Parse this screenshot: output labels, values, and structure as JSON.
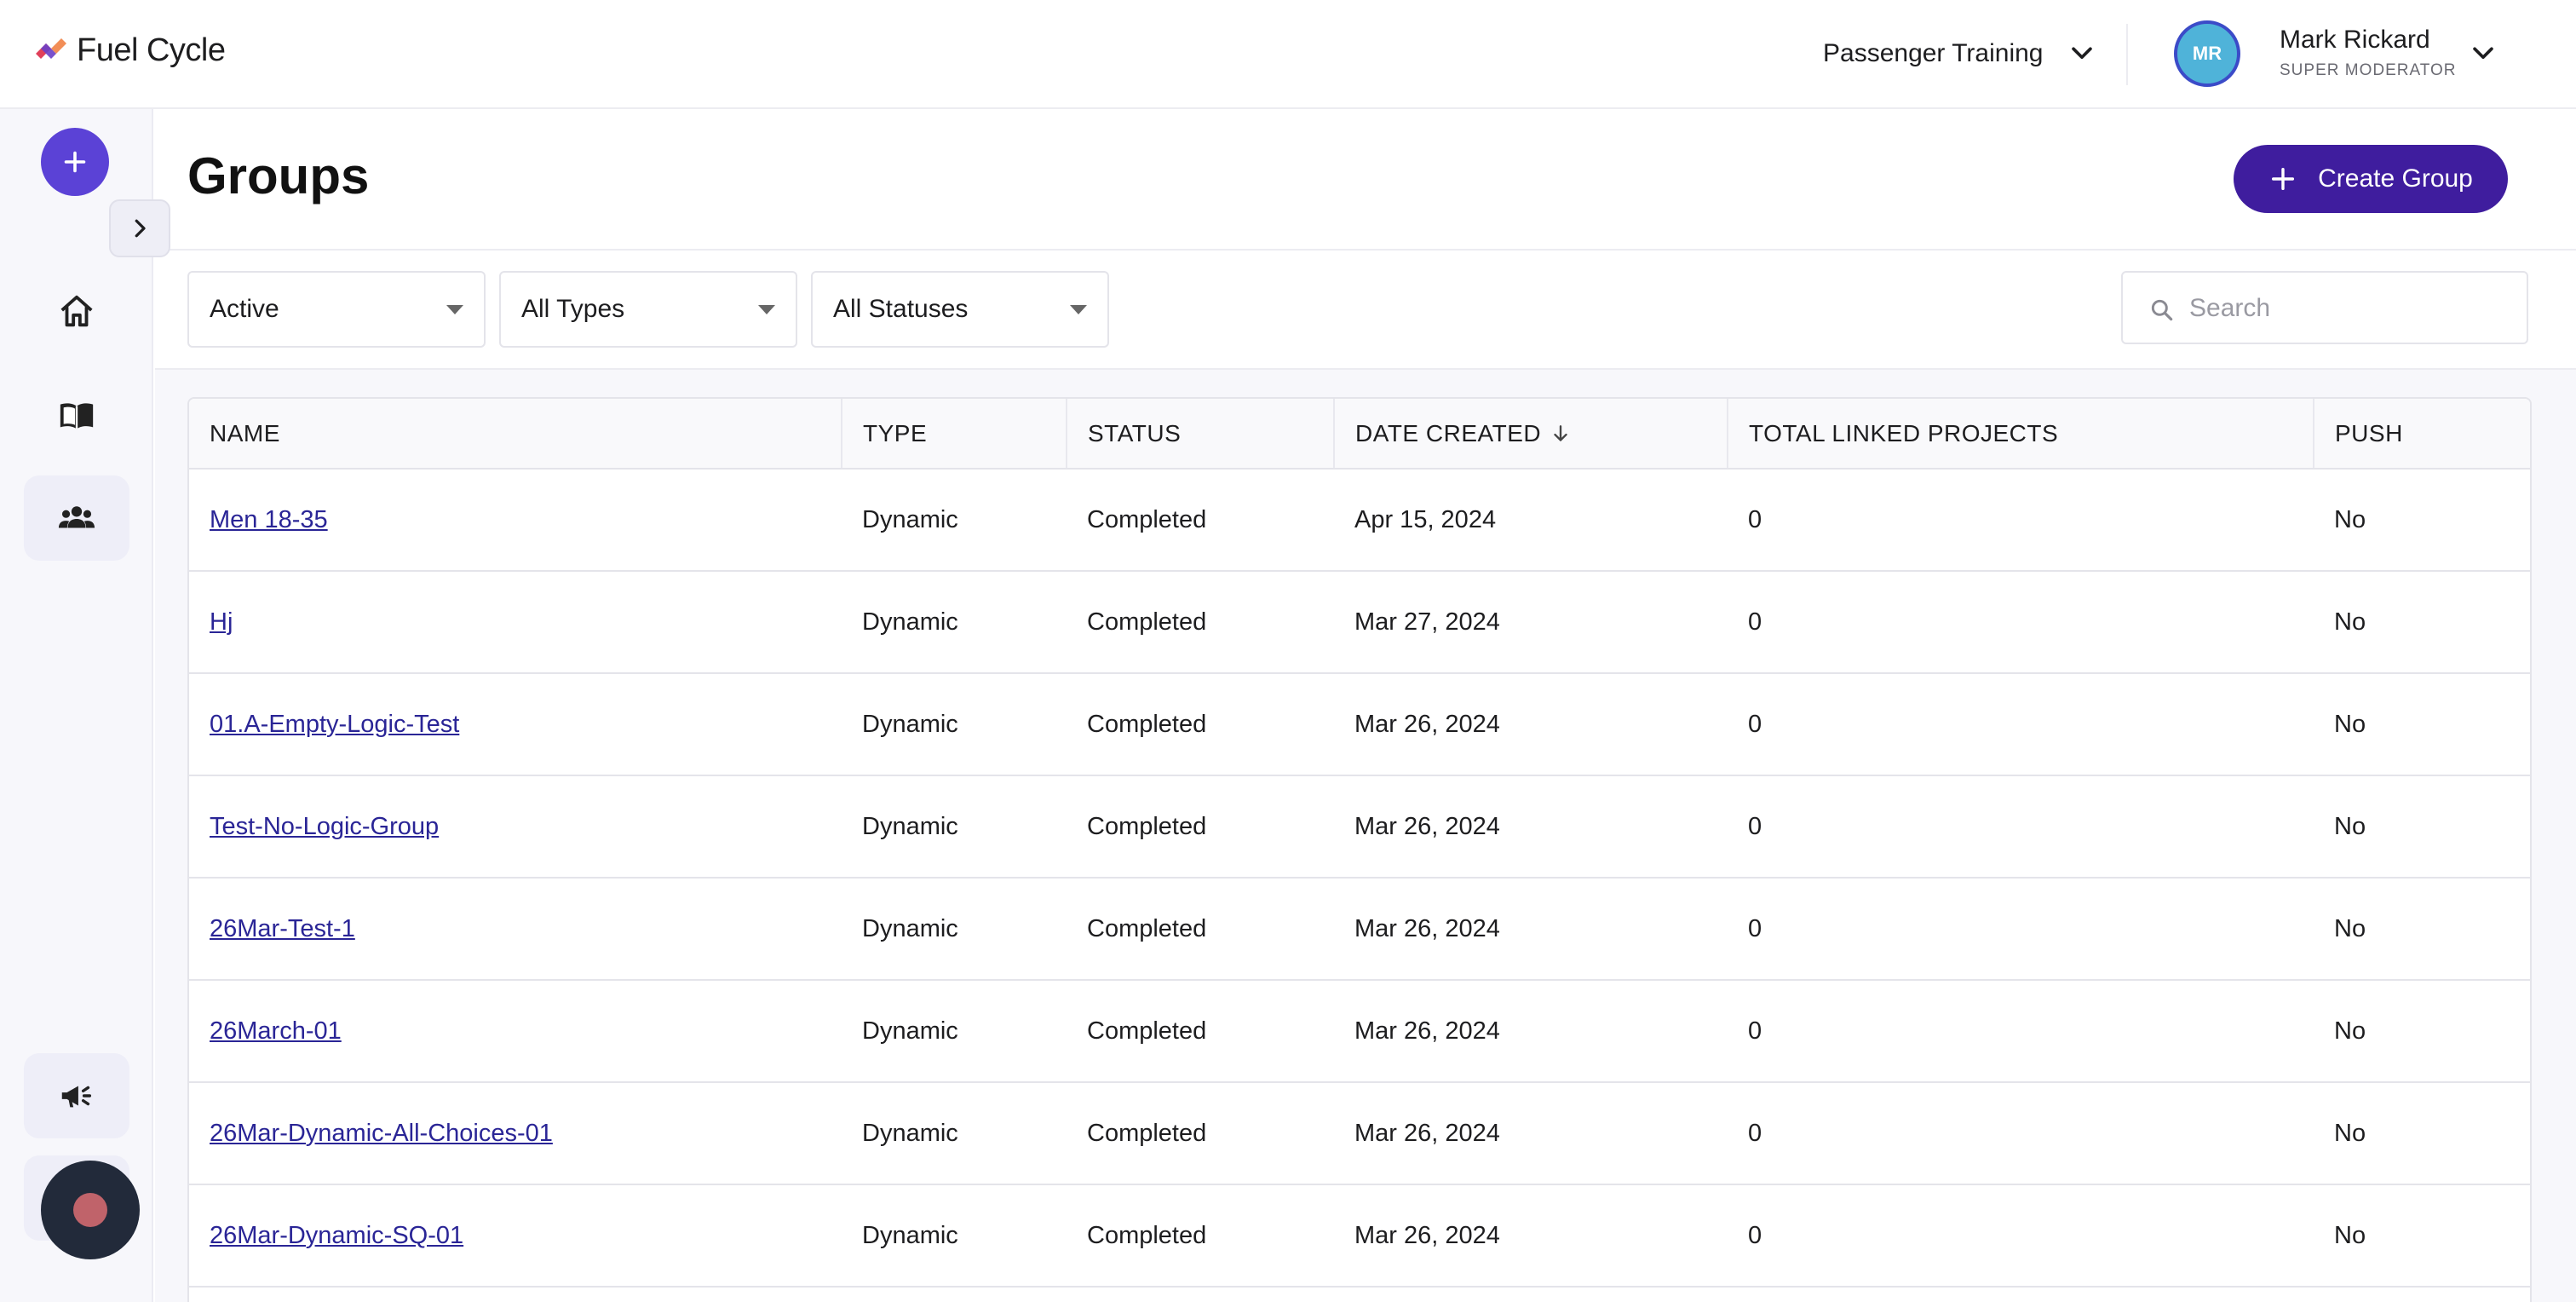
{
  "header": {
    "logo_text": "Fuel Cycle",
    "project": "Passenger Training",
    "user": {
      "initials": "MR",
      "name": "Mark Rickard",
      "role": "SUPER MODERATOR"
    }
  },
  "sidebar": {
    "items": [
      {
        "name": "home",
        "icon": "home-icon"
      },
      {
        "name": "library",
        "icon": "book-icon"
      },
      {
        "name": "groups",
        "icon": "users-icon",
        "active": true
      },
      {
        "name": "announcements",
        "icon": "megaphone-icon"
      }
    ]
  },
  "page": {
    "title": "Groups",
    "create_label": "Create Group"
  },
  "filters": {
    "state": "Active",
    "type": "All Types",
    "status": "All Statuses",
    "search_placeholder": "Search"
  },
  "table": {
    "columns": [
      "NAME",
      "TYPE",
      "STATUS",
      "DATE CREATED",
      "TOTAL LINKED PROJECTS",
      "PUSH"
    ],
    "rows": [
      {
        "name": "Men 18-35",
        "type": "Dynamic",
        "status": "Completed",
        "date": "Apr 15, 2024",
        "linked": "0",
        "push": "No"
      },
      {
        "name": "Hj",
        "type": "Dynamic",
        "status": "Completed",
        "date": "Mar 27, 2024",
        "linked": "0",
        "push": "No"
      },
      {
        "name": "01.A-Empty-Logic-Test",
        "type": "Dynamic",
        "status": "Completed",
        "date": "Mar 26, 2024",
        "linked": "0",
        "push": "No"
      },
      {
        "name": "Test-No-Logic-Group",
        "type": "Dynamic",
        "status": "Completed",
        "date": "Mar 26, 2024",
        "linked": "0",
        "push": "No"
      },
      {
        "name": "26Mar-Test-1",
        "type": "Dynamic",
        "status": "Completed",
        "date": "Mar 26, 2024",
        "linked": "0",
        "push": "No"
      },
      {
        "name": "26March-01",
        "type": "Dynamic",
        "status": "Completed",
        "date": "Mar 26, 2024",
        "linked": "0",
        "push": "No"
      },
      {
        "name": "26Mar-Dynamic-All-Choices-01",
        "type": "Dynamic",
        "status": "Completed",
        "date": "Mar 26, 2024",
        "linked": "0",
        "push": "No"
      },
      {
        "name": "26Mar-Dynamic-SQ-01",
        "type": "Dynamic",
        "status": "Completed",
        "date": "Mar 26, 2024",
        "linked": "0",
        "push": "No"
      }
    ]
  },
  "colors": {
    "primary": "#3f1d9e",
    "fab": "#5b42d6",
    "link": "#2a2596",
    "avatar": "#4fb3d9"
  }
}
